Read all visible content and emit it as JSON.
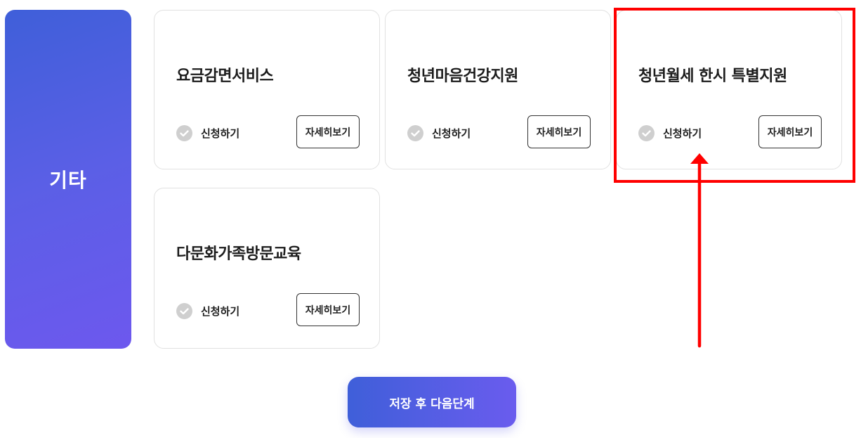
{
  "category": {
    "label": "기타"
  },
  "cards": [
    {
      "title": "요금감면서비스",
      "apply_label": "신청하기",
      "detail_label": "자세히보기"
    },
    {
      "title": "청년마음건강지원",
      "apply_label": "신청하기",
      "detail_label": "자세히보기"
    },
    {
      "title": "청년월세 한시 특별지원",
      "apply_label": "신청하기",
      "detail_label": "자세히보기"
    },
    {
      "title": "다문화가족방문교육",
      "apply_label": "신청하기",
      "detail_label": "자세히보기"
    }
  ],
  "footer": {
    "next_label": "저장 후 다음단계"
  },
  "colors": {
    "accent_start": "#3f5fd9",
    "accent_end": "#6d58ee",
    "highlight": "#ff0000",
    "check_gray": "#cfcfcf"
  },
  "icons": {
    "check": "check-circle-icon",
    "arrow": "arrow-up-icon"
  }
}
